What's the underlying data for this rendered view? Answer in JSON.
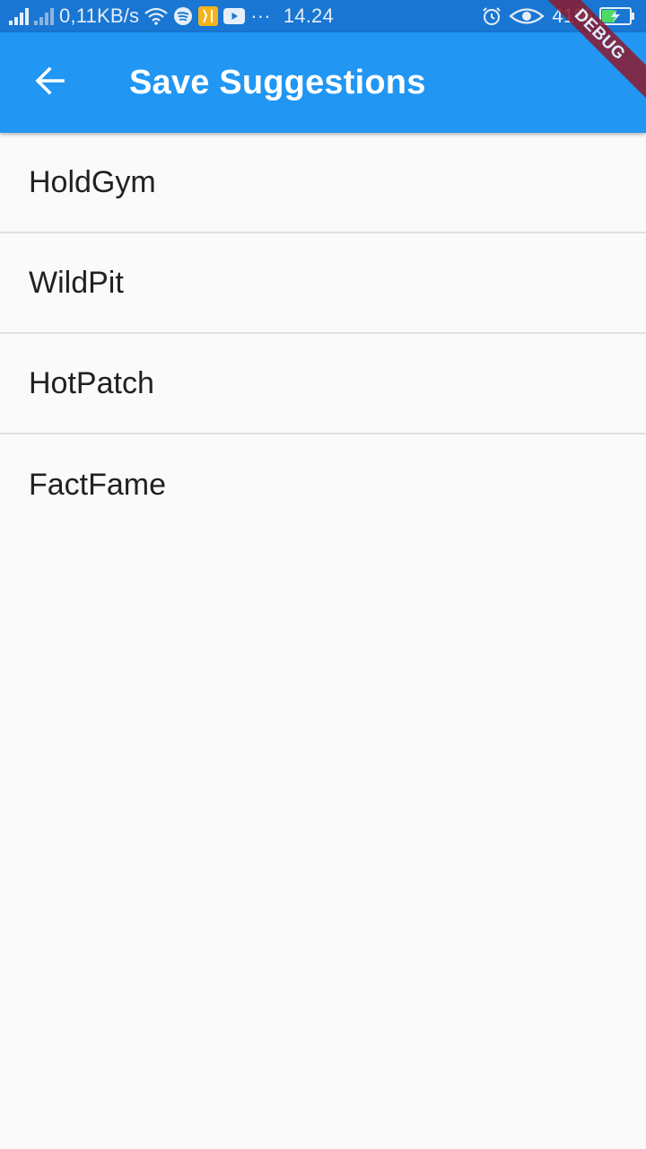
{
  "status_bar": {
    "net_speed": "0,11KB/s",
    "more": "···",
    "time": "14.24",
    "battery_percent": "41%",
    "colors": {
      "background": "#1976d2"
    }
  },
  "app_bar": {
    "title": "Save Suggestions",
    "back_icon": "arrow-back-icon",
    "colors": {
      "background": "#2196f3",
      "text": "#ffffff"
    }
  },
  "debug_banner": {
    "label": "DEBUG",
    "color": "#8b1a2e"
  },
  "saved_list": {
    "items": [
      {
        "label": "HoldGym"
      },
      {
        "label": "WildPit"
      },
      {
        "label": "HotPatch"
      },
      {
        "label": "FactFame"
      }
    ]
  }
}
